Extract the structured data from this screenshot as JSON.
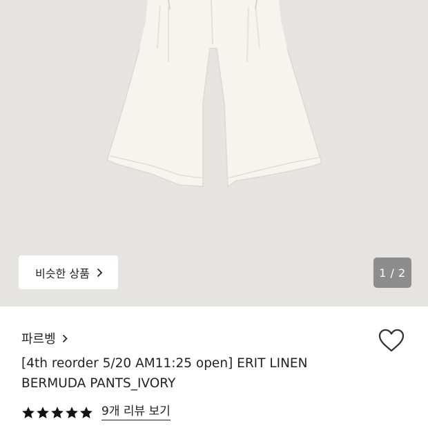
{
  "product": {
    "similar_button_label": "비슷한 상품",
    "page_indicator": "1 / 2",
    "brand": "파르벵",
    "title_line1": "[4th reorder 5/20 AM11:25 open] ERIT LINEN",
    "title_line2": "BERMUDA PANTS_IVORY",
    "rating": {
      "stars": 5,
      "max": 5
    },
    "review_link": "9개 리뷰 보기",
    "wishlist_icon": "heart-outline-icon"
  },
  "colors": {
    "photo_background": "#e6e4e1",
    "page_indicator_bg": "#8d8d8d",
    "text": "#222222",
    "star": "#111111"
  }
}
